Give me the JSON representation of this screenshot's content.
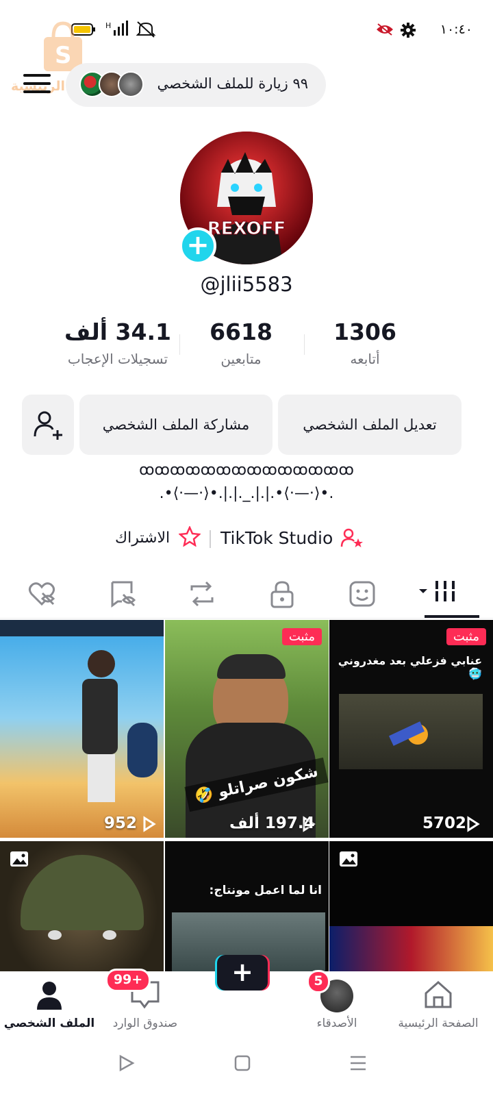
{
  "status": {
    "time": "١٠:٤٠",
    "signal_text": "H",
    "icons": [
      "battery-icon",
      "signal-icon",
      "mute-icon",
      "eye-icon",
      "settings-gear-icon"
    ]
  },
  "watermark": {
    "text": "قة الرئيسية"
  },
  "header": {
    "visits_label": "٩٩ زيارة للملف الشخصي"
  },
  "profile": {
    "avatar_text": "REXOFF",
    "username": "@jlii5583"
  },
  "stats": {
    "following": {
      "value": "1306",
      "label": "أتابعه"
    },
    "followers": {
      "value": "6618",
      "label": "متابعين"
    },
    "likes": {
      "value": "34.1 ألف",
      "label": "تسجيلات الإعجاب"
    }
  },
  "actions": {
    "edit_profile": "تعديل الملف الشخصي",
    "share_profile": "مشاركة الملف الشخصي"
  },
  "bio": {
    "line1": "ꝏꝏꝏꝏꝏꝏꝏꝏꝏꝏꝏꝏꝏꝏ",
    "line2": ".•⟨·—·⟩•.|.|._.|.|.•⟨·—·⟩•."
  },
  "links": {
    "studio": "TikTok Studio",
    "subscribe": "الاشتراك"
  },
  "tabs": [
    "videos-grid-icon",
    "favorites-icon",
    "private-lock-icon",
    "repost-icon",
    "tagged-icon",
    "liked-icon"
  ],
  "grid": [
    {
      "views": "5702",
      "pinned": true,
      "pin_label": "مثبت",
      "caption": "عنابي فزعلي بعد مغدروني 🥶"
    },
    {
      "views": "197.4 ألف",
      "pinned": true,
      "pin_label": "مثبت",
      "caption": "شكون صراتلو 🤣"
    },
    {
      "views": "952",
      "pinned": false,
      "caption": ""
    },
    {
      "views": "",
      "pinned": false,
      "caption": ""
    },
    {
      "views": "",
      "pinned": false,
      "caption": "انا لما اعمل مونتاج:"
    },
    {
      "views": "",
      "pinned": false,
      "caption": ""
    }
  ],
  "bottom_nav": {
    "home": "الصفحة الرئيسية",
    "friends": "الأصدقاء",
    "friends_badge": "5",
    "inbox": "صندوق الوارد",
    "inbox_badge": "99+",
    "profile": "الملف الشخصي"
  },
  "colors": {
    "accent": "#fe2c55",
    "cyan": "#20d5ec",
    "text": "#161823",
    "muted": "#6f7077"
  }
}
